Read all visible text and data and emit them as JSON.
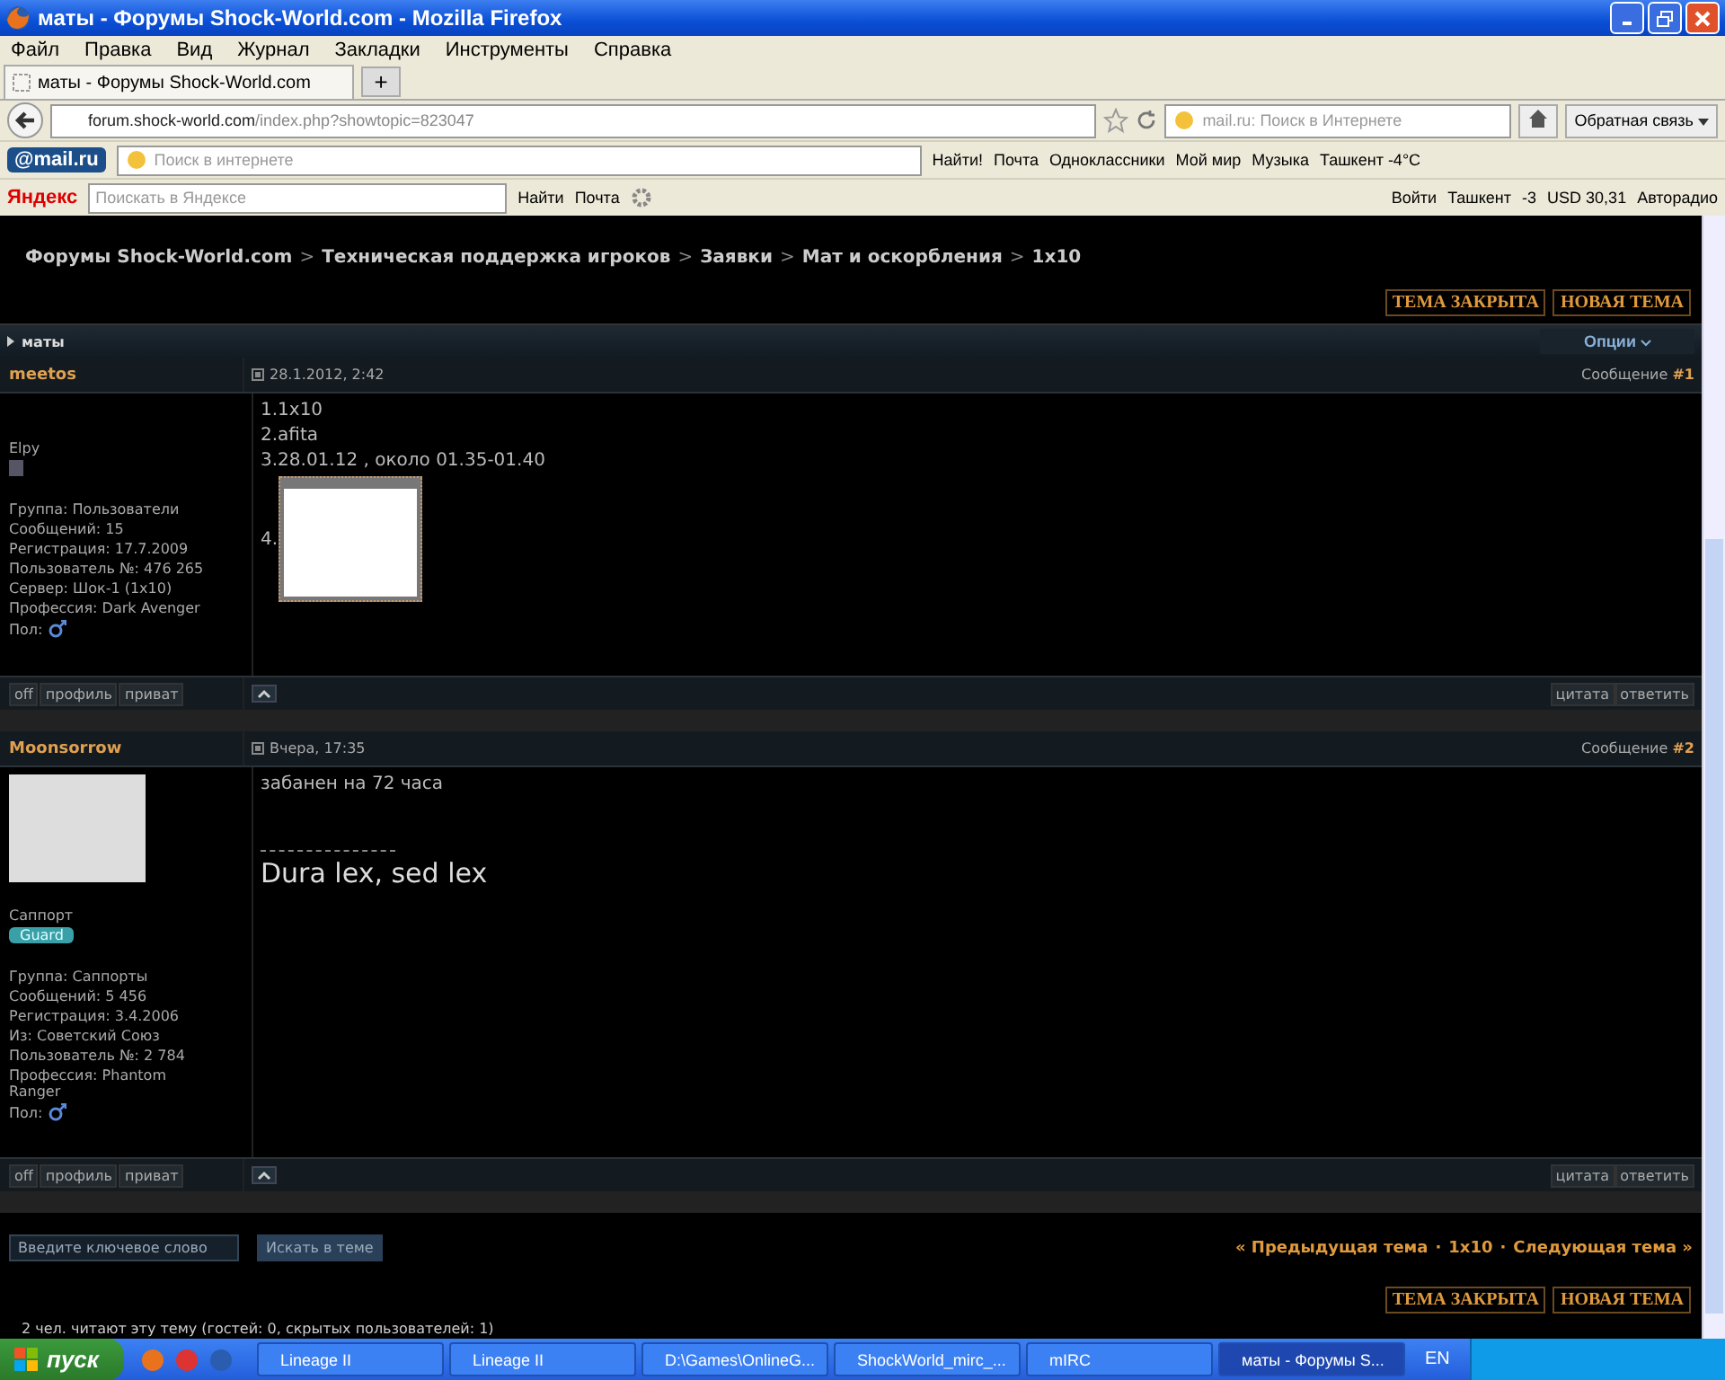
{
  "window": {
    "title": "маты - Форумы Shock-World.com - Mozilla Firefox"
  },
  "menu": [
    "Файл",
    "Правка",
    "Вид",
    "Журнал",
    "Закладки",
    "Инструменты",
    "Справка"
  ],
  "tabs": [
    {
      "label": "маты - Форумы Shock-World.com",
      "selected": true
    }
  ],
  "new_tab": "+",
  "address": {
    "host": "forum.shock-world.com",
    "path": "/index.php?showtopic=823047"
  },
  "search": {
    "placeholder": "mail.ru: Поиск в Интернете"
  },
  "feedback": "Обратная связь",
  "mailru_bar": {
    "logo": "@mail.ru",
    "placeholder": "Поиск в интернете",
    "find": "Найти!",
    "links": [
      "Почта",
      "Одноклассники",
      "Мой мир",
      "Музыка",
      "Ташкент -4°C"
    ]
  },
  "yandex_bar": {
    "logo": "Яндекс",
    "placeholder": "Поискать в Яндексе",
    "find": "Найти",
    "mail": "Почта",
    "login": "Войти",
    "city": "Ташкент",
    "temp": "-3",
    "currency": "USD 30,31",
    "radio": "Авторадио"
  },
  "forum": {
    "breadcrumb_separator": ">",
    "breadcrumb": [
      "Форумы Shock-World.com",
      "Техническая поддержка игроков",
      "Заявки",
      "Мат и оскорбления",
      "1x10"
    ],
    "topic_buttons": [
      "ТЕМА ЗАКРЫТА",
      "НОВАЯ ТЕМА"
    ],
    "topic_title": "маты",
    "options": "Опции",
    "posts": [
      {
        "author": "meetos",
        "date": "28.1.2012, 2:42",
        "number_label": "Сообщение",
        "number": "#1",
        "avatar": false,
        "member_title": "Elpy",
        "info": [
          "Группа: Пользователи",
          "Сообщений: 15",
          "Регистрация: 17.7.2009",
          "Пользователь №: 476 265",
          "Сервер: Шок-1 (1x10)",
          "Профессия: Dark Avenger"
        ],
        "gender": "Пол:",
        "lines": [
          "1.1x10",
          "2.afita",
          "3.28.01.12 , около 01.35-01.40"
        ],
        "image_prefix": "4.",
        "user_buttons": [
          "off",
          "профиль",
          "приват"
        ],
        "post_buttons": [
          "цитата",
          "ответить"
        ]
      },
      {
        "author": "Moonsorrow",
        "date": "Вчера, 17:35",
        "number_label": "Сообщение",
        "number": "#2",
        "avatar": true,
        "member_title": "Саппорт",
        "badge": "Guard",
        "info": [
          "Группа: Саппорты",
          "Сообщений: 5 456",
          "Регистрация: 3.4.2006",
          "Из: Советский Союз",
          "Пользователь №: 2 784",
          "Профессия: Phantom Ranger"
        ],
        "gender": "Пол:",
        "lines": [
          "забанен на 72 часа"
        ],
        "signature": "Dura lex, sed lex",
        "user_buttons": [
          "off",
          "профиль",
          "приват"
        ],
        "post_buttons": [
          "цитата",
          "ответить"
        ]
      }
    ],
    "search_placeholder": "Введите ключевое слово",
    "search_button": "Искать в теме",
    "nav": {
      "separator": "·",
      "prev": "« Предыдущая тема",
      "current": "1x10",
      "next": "Следующая тема »"
    },
    "bottom_buttons": [
      "ТЕМА ЗАКРЫТА",
      "НОВАЯ ТЕМА"
    ],
    "readers": "2 чел. читают эту тему (гостей: 0, скрытых пользователей: 1)"
  },
  "taskbar": {
    "start": "пуск",
    "tasks": [
      {
        "label": "Lineage II",
        "selected": false
      },
      {
        "label": "Lineage II",
        "selected": false
      },
      {
        "label": "D:\\Games\\OnlineG...",
        "selected": false
      },
      {
        "label": "ShockWorld_mirc_...",
        "selected": false
      },
      {
        "label": "mIRC",
        "selected": false
      },
      {
        "label": "маты - Форумы S...",
        "selected": true
      }
    ],
    "lang": "EN"
  }
}
